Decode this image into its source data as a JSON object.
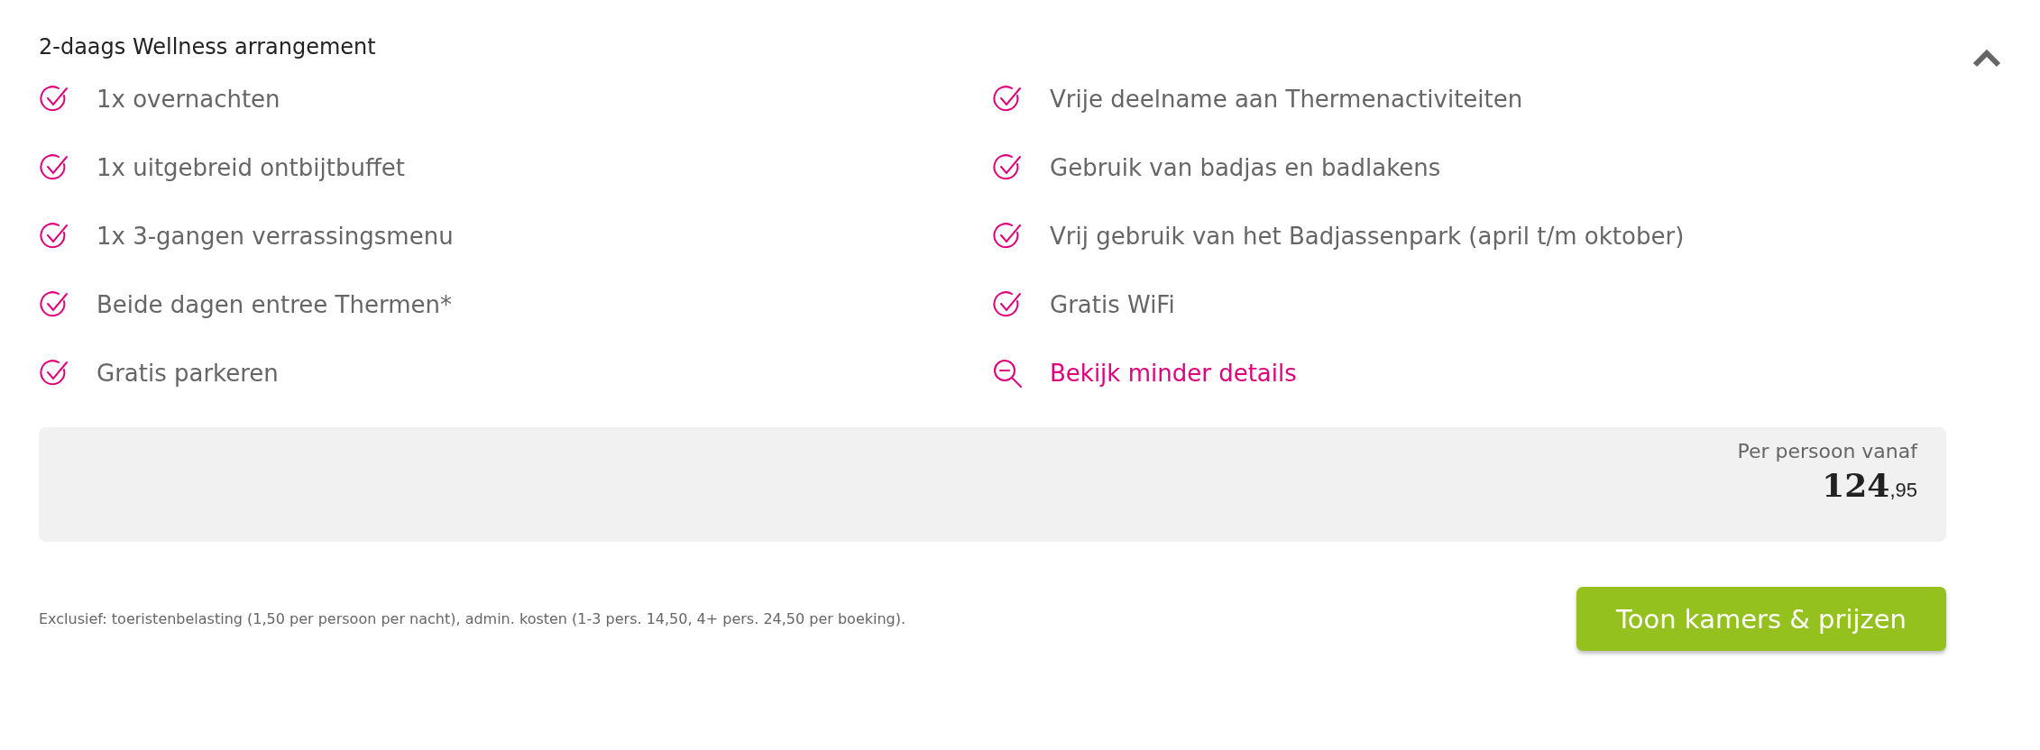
{
  "title": "2-daags Wellness arrangement",
  "collapse": {
    "expanded": true
  },
  "columns": [
    {
      "items": [
        {
          "kind": "check",
          "label": "1x overnachten"
        },
        {
          "kind": "check",
          "label": "1x uitgebreid ontbijtbuffet"
        },
        {
          "kind": "check",
          "label": "1x 3-gangen verrassingsmenu"
        },
        {
          "kind": "check",
          "label": "Beide dagen entree Thermen*"
        },
        {
          "kind": "check",
          "label": "Gratis parkeren"
        }
      ]
    },
    {
      "items": [
        {
          "kind": "check",
          "label": "Vrije deelname aan Thermenactiviteiten"
        },
        {
          "kind": "check",
          "label": "Gebruik van badjas en badlakens"
        },
        {
          "kind": "check",
          "label": "Vrij gebruik van het Badjassenpark (april t/m oktober)"
        },
        {
          "kind": "check",
          "label": "Gratis WiFi"
        },
        {
          "kind": "link",
          "label": "Bekijk minder details"
        }
      ]
    }
  ],
  "price": {
    "caption": "Per persoon vanaf",
    "whole": "124",
    "cents": ",95"
  },
  "footnote": "Exclusief: toeristenbelasting (1,50 per persoon per nacht), admin. kosten (1-3 pers. 14,50, 4+ pers. 24,50 per boeking).",
  "button": "Toon kamers & prijzen"
}
